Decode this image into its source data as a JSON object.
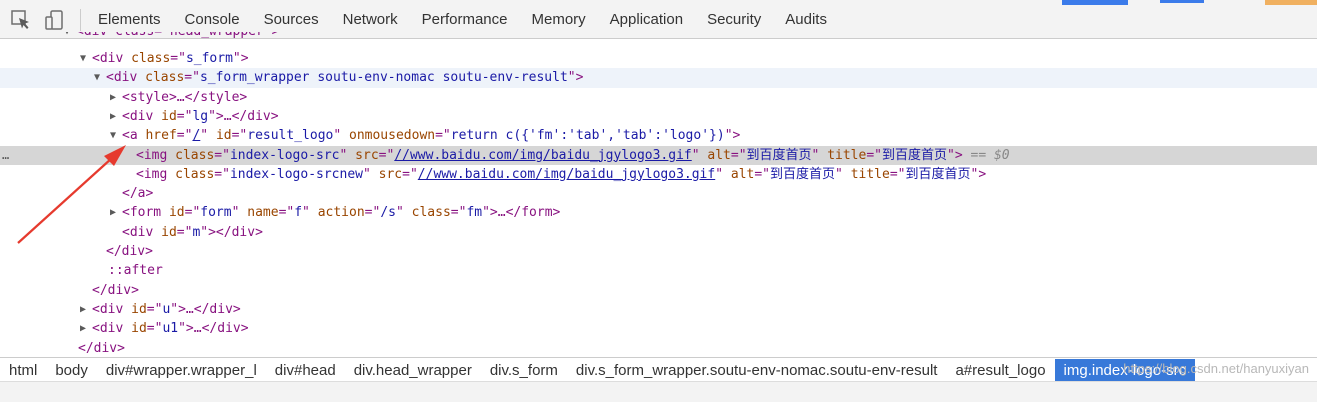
{
  "colors": {
    "tag": "#881280",
    "attr_name": "#994500",
    "attr_value": "#1a1aa6",
    "selected_row": "#d6d6d6",
    "active_crumb": "#3879d9",
    "annotation_arrow": "#e63a2e"
  },
  "toolbar": {
    "icons": [
      "inspect-element-icon",
      "device-toolbar-icon"
    ],
    "tabs": [
      {
        "label": "Elements",
        "active": true
      },
      {
        "label": "Console"
      },
      {
        "label": "Sources"
      },
      {
        "label": "Network"
      },
      {
        "label": "Performance"
      },
      {
        "label": "Memory"
      },
      {
        "label": "Application"
      },
      {
        "label": "Security"
      },
      {
        "label": "Audits"
      }
    ]
  },
  "tree": {
    "l0": {
      "text": "<div class=\"head_wrapper\">"
    },
    "l1": {
      "open": "<div ",
      "a1": "class",
      "eq1": "=\"",
      "v1": "s_form",
      "close": "\">"
    },
    "l2": {
      "open": "<div ",
      "a1": "class",
      "eq1": "=\"",
      "v1": "s_form_wrapper soutu-env-nomac soutu-env-result",
      "close": "\">"
    },
    "l3": {
      "text": "<style>…</style>"
    },
    "l4": {
      "open": "<div ",
      "a1": "id",
      "eq1": "=\"",
      "v1": "lg",
      "close": "\">…</div>"
    },
    "l5": {
      "open": "<a ",
      "a1": "href",
      "eq1": "=\"",
      "v1": "/",
      "q1": "\" ",
      "a2": "id",
      "eq2": "=\"",
      "v2": "result_logo",
      "q2": "\" ",
      "a3": "onmousedown",
      "eq3": "=\"",
      "v3": "return c({'fm':'tab','tab':'logo'})",
      "close": "\">"
    },
    "l6": {
      "open": "<img ",
      "a1": "class",
      "eq1": "=\"",
      "v1": "index-logo-src",
      "q1": "\" ",
      "a2": "src",
      "eq2": "=\"",
      "v2": "//www.baidu.com/img/baidu_jgylogo3.gif",
      "q2": "\" ",
      "a3": "alt",
      "eq3": "=\"",
      "v3": "到百度首页",
      "q3": "\" ",
      "a4": "title",
      "eq4": "=\"",
      "v4": "到百度首页",
      "close": "\">",
      "suffix": " == $0",
      "dots": "…"
    },
    "l7": {
      "open": "<img ",
      "a1": "class",
      "eq1": "=\"",
      "v1": "index-logo-srcnew",
      "q1": "\" ",
      "a2": "src",
      "eq2": "=\"",
      "v2": "//www.baidu.com/img/baidu_jgylogo3.gif",
      "q2": "\" ",
      "a3": "alt",
      "eq3": "=\"",
      "v3": "到百度首页",
      "q3": "\" ",
      "a4": "title",
      "eq4": "=\"",
      "v4": "到百度首页",
      "close": "\">"
    },
    "l8": {
      "text": "</a>"
    },
    "l9": {
      "open": "<form ",
      "a1": "id",
      "eq1": "=\"",
      "v1": "form",
      "q1": "\" ",
      "a2": "name",
      "eq2": "=\"",
      "v2": "f",
      "q2": "\" ",
      "a3": "action",
      "eq3": "=\"",
      "v3": "/s",
      "q3": "\" ",
      "a4": "class",
      "eq4": "=\"",
      "v4": "fm",
      "close": "\">…</form>"
    },
    "l10": {
      "open": "<div ",
      "a1": "id",
      "eq1": "=\"",
      "v1": "m",
      "close": "\"></div>"
    },
    "l11": {
      "text": "</div>"
    },
    "l12": {
      "text": "::after"
    },
    "l13": {
      "text": "</div>"
    },
    "l14": {
      "open": "<div ",
      "a1": "id",
      "eq1": "=\"",
      "v1": "u",
      "close": "\">…</div>"
    },
    "l15": {
      "open": "<div ",
      "a1": "id",
      "eq1": "=\"",
      "v1": "u1",
      "close": "\">…</div>"
    },
    "l16": {
      "text": "</div>"
    }
  },
  "breadcrumbs": [
    "html",
    "body",
    "div#wrapper.wrapper_l",
    "div#head",
    "div.head_wrapper",
    "div.s_form",
    "div.s_form_wrapper.soutu-env-nomac.soutu-env-result",
    "a#result_logo",
    "img.index-logo-src"
  ],
  "watermark": "https://blog.csdn.net/hanyuxiyan"
}
